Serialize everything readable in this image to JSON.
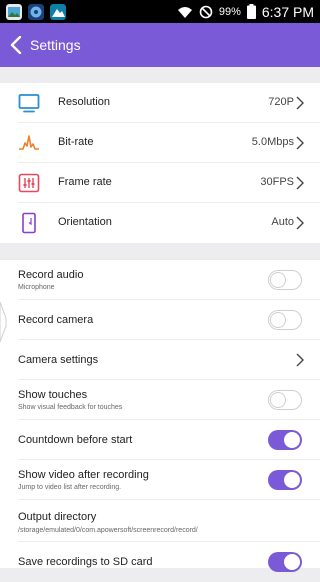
{
  "status_bar": {
    "battery": "99%",
    "time": "6:37 PM"
  },
  "header": {
    "title": "Settings"
  },
  "quality": [
    {
      "label": "Resolution",
      "value": "720P",
      "icon": "monitor-icon"
    },
    {
      "label": "Bit-rate",
      "value": "5.0Mbps",
      "icon": "waveform-icon"
    },
    {
      "label": "Frame rate",
      "value": "30FPS",
      "icon": "sliders-icon"
    },
    {
      "label": "Orientation",
      "value": "Auto",
      "icon": "phone-rotate-icon"
    }
  ],
  "settings": [
    {
      "title": "Record audio",
      "subtitle": "Microphone",
      "toggle": false
    },
    {
      "title": "Record camera",
      "subtitle": "",
      "toggle": false
    },
    {
      "title": "Camera settings",
      "subtitle": "",
      "chevron": true
    },
    {
      "title": "Show touches",
      "subtitle": "Show visual feedback for touches",
      "toggle": false
    },
    {
      "title": "Countdown before start",
      "subtitle": "",
      "toggle": true
    },
    {
      "title": "Show video after recording",
      "subtitle": "Jump to video list after recording.",
      "toggle": true
    },
    {
      "title": "Output directory",
      "subtitle": "/storage/emulated/0/com.apowersoft/screenrecord/record/"
    },
    {
      "title": "Save recordings to SD card",
      "subtitle": "",
      "toggle": true
    }
  ],
  "colors": {
    "accent": "#7a5ad6",
    "resolution_icon": "#2a8fd0",
    "bitrate_icon": "#f07f2a",
    "framerate_icon": "#e8485a",
    "orientation_icon": "#8a3fc9"
  }
}
